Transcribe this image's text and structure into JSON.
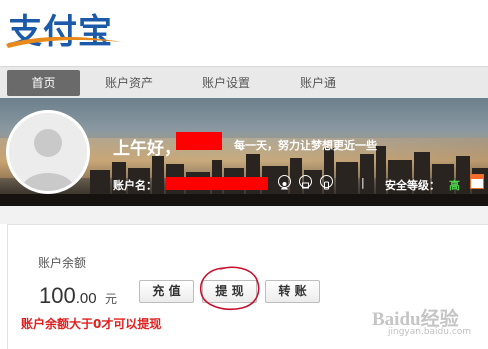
{
  "logo": {
    "text": "支付宝"
  },
  "nav": {
    "items": [
      {
        "label": "首页",
        "active": true
      },
      {
        "label": "账户资产",
        "active": false
      },
      {
        "label": "账户设置",
        "active": false
      },
      {
        "label": "账户通",
        "active": false
      }
    ]
  },
  "banner": {
    "greeting": "上午好，",
    "motto": "每一天，努力让梦想更近一些",
    "account_label": "账户名：",
    "security_label": "安全等级：",
    "security_level": "高",
    "separator": "|"
  },
  "account": {
    "balance_label": "账户余额",
    "balance_int": "100",
    "balance_dec": ".00",
    "balance_unit": "元",
    "buttons": {
      "recharge": "充 值",
      "withdraw": "提 现",
      "transfer": "转 账"
    },
    "note": "账户余额大于0才可以提现"
  },
  "watermark": {
    "text": "Baidu经验",
    "sub": "jingyan.baidu.com"
  },
  "colors": {
    "brand_blue": "#1a5aa8",
    "redaction": "#ff0000",
    "note_red": "#e01e1e",
    "security_green": "#4cd04c"
  },
  "icons": [
    "user-icon",
    "id-card-icon",
    "phone-icon",
    "calendar-icon"
  ]
}
